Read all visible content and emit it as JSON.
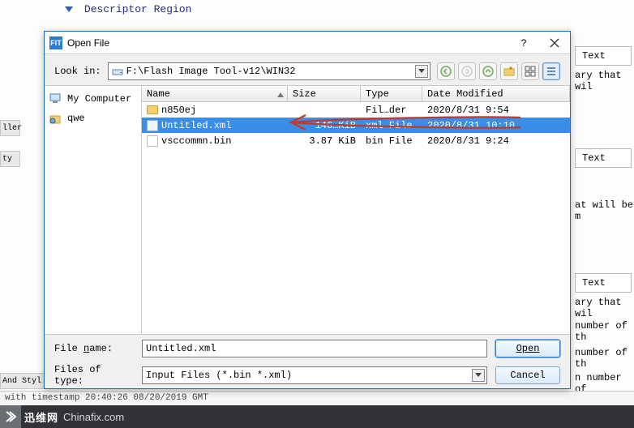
{
  "background": {
    "header": "Descriptor Region",
    "side_items": [
      "ller",
      "ty",
      "And Styl"
    ],
    "right_labels": [
      "Text",
      "ary that wil",
      "Text",
      "at will be m",
      "Text",
      "ary that wil",
      "number of th",
      "number of th",
      "n number of"
    ],
    "status_line": "with timestamp 20:40:26 08/20/2019 GMT",
    "footer_brand": "迅维网",
    "footer_domain": "Chinafix.com"
  },
  "dialog": {
    "title": "Open File",
    "lookin_label": "Look in:",
    "path": "F:\\Flash Image Tool-v12\\WIN32",
    "toolbar_icons": [
      "back-icon",
      "forward-icon",
      "up-icon",
      "new-folder-icon",
      "list-view-icon",
      "details-view-icon"
    ],
    "columns": [
      "Name",
      "Size",
      "Type",
      "Date Modified"
    ],
    "sidebar": [
      {
        "icon": "computer-icon",
        "label": "My Computer"
      },
      {
        "icon": "user-icon",
        "label": "qwe"
      }
    ],
    "files": [
      {
        "icon": "folder",
        "name": "n850ej",
        "size": "",
        "type": "Fil…der",
        "date": "2020/8/31 9:54",
        "selected": false
      },
      {
        "icon": "xml",
        "name": "Untitled.xml",
        "size": "146…KiB",
        "type": "xml File",
        "date": "2020/8/31 10:10",
        "selected": true
      },
      {
        "icon": "file",
        "name": "vsccommn.bin",
        "size": "3.87 KiB",
        "type": "bin File",
        "date": "2020/8/31 9:24",
        "selected": false
      }
    ],
    "filename_label": "File name:",
    "filename_value": "Untitled.xml",
    "filter_label": "Files of type:",
    "filter_value": "Input Files (*.bin *.xml)",
    "open_btn": "Open",
    "cancel_btn": "Cancel"
  }
}
